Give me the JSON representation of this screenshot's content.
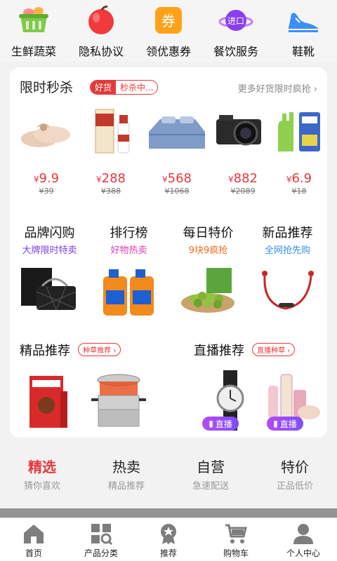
{
  "top_icons": [
    {
      "label": "生鲜蔬菜",
      "icon": "basket-icon"
    },
    {
      "label": "隐私协议",
      "icon": "apple-icon"
    },
    {
      "label": "领优惠券",
      "icon": "coupon-icon"
    },
    {
      "label": "餐饮服务",
      "icon": "planet-icon"
    },
    {
      "label": "鞋靴",
      "icon": "shoe-icon"
    }
  ],
  "coupon_glyph": "券",
  "planet_text": "进口",
  "flash_sale": {
    "title": "限时秒杀",
    "tag_a": "好货",
    "tag_b": "秒杀中...",
    "more": "更多好货限时疯抢 ›",
    "products": [
      {
        "price": "9.9",
        "old": "¥39",
        "image": "slippers"
      },
      {
        "price": "288",
        "old": "¥388",
        "image": "liquor"
      },
      {
        "price": "568",
        "old": "¥1068",
        "image": "bed"
      },
      {
        "price": "882",
        "old": "¥2089",
        "image": "camera"
      },
      {
        "price": "6.9",
        "old": "¥18",
        "image": "gloves"
      }
    ],
    "currency": "¥"
  },
  "categories": [
    {
      "title": "品牌闪购",
      "sub": "大牌限时特卖",
      "sub_color": "#7b3fe4"
    },
    {
      "title": "排行榜",
      "sub": "好物热卖",
      "sub_color": "#d93fb5"
    },
    {
      "title": "每日特价",
      "sub": "9块9疯抢",
      "sub_color": "#f06a1d"
    },
    {
      "title": "新品推荐",
      "sub": "全网抢先购",
      "sub_color": "#3a8ee6"
    }
  ],
  "recommend": {
    "title": "精品推荐",
    "pill": "种草推荐 ›"
  },
  "live": {
    "title": "直播推荐",
    "pill": "直播种草 ›",
    "badge": "直播"
  },
  "tabs": [
    {
      "title": "精选",
      "sub": "猜你喜欢",
      "active": true
    },
    {
      "title": "热卖",
      "sub": "精品推荐",
      "active": false
    },
    {
      "title": "自营",
      "sub": "急速配送",
      "active": false
    },
    {
      "title": "特价",
      "sub": "正品低价",
      "active": false
    }
  ],
  "bottom_nav": [
    {
      "label": "首页",
      "icon": "home-icon"
    },
    {
      "label": "产品分类",
      "icon": "category-icon"
    },
    {
      "label": "推荐",
      "icon": "badge-star-icon"
    },
    {
      "label": "购物车",
      "icon": "cart-icon"
    },
    {
      "label": "个人中心",
      "icon": "person-icon"
    }
  ],
  "colors": {
    "accent": "#e4393c",
    "nav_icon": "#7d7d7d"
  }
}
